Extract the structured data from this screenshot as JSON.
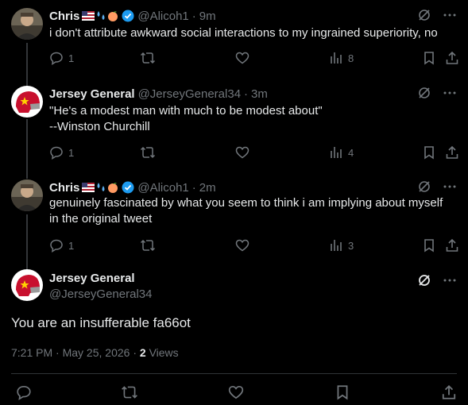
{
  "replies": [
    {
      "name": "Chris",
      "handle": "@Alicoh1",
      "time": "9m",
      "text": "i don't attribute awkward social interactions to my ingrained superiority, no",
      "reply_count": "1",
      "views": "8",
      "avatar": "chris-avatar"
    },
    {
      "name": "Jersey General",
      "handle": "@JerseyGeneral34",
      "time": "3m",
      "text_line1": "\"He's a modest man with much to be modest about\"",
      "text_line2": "--Winston Churchill",
      "reply_count": "1",
      "views": "4",
      "avatar": "helmet-avatar"
    },
    {
      "name": "Chris",
      "handle": "@Alicoh1",
      "time": "2m",
      "text_line1": "genuinely fascinated by what you seem to think i am implying about myself",
      "text_line2": "in the original tweet",
      "reply_count": "1",
      "views": "3",
      "avatar": "chris-avatar"
    }
  ],
  "main": {
    "name": "Jersey General",
    "handle": "@JerseyGeneral34",
    "text": "You are an insufferable fa66ot",
    "time": "7:21 PM",
    "date": "May 25, 2026",
    "views_count": "2",
    "views_label": "Views"
  },
  "separator": "·",
  "colors": {
    "background": "#000000",
    "text": "#e7e9ea",
    "muted": "#71767b",
    "verified": "#1d9bf0",
    "helmet_red": "#c8102e"
  }
}
